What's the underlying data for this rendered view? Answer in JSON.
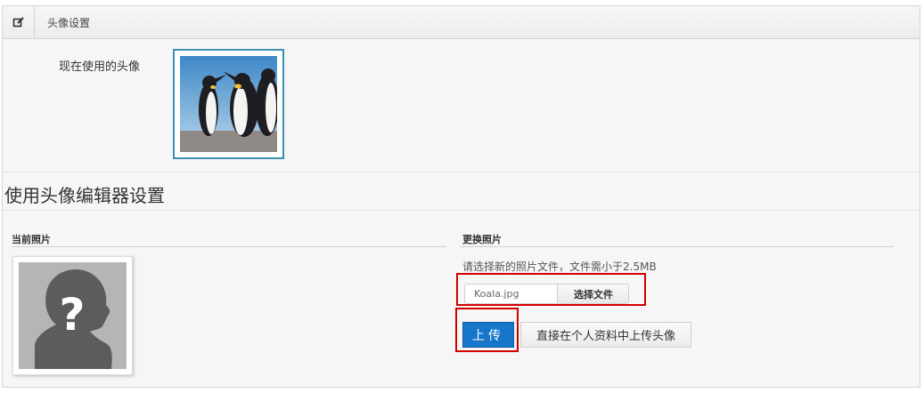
{
  "header": {
    "icon": "edit-icon",
    "title": "头像设置"
  },
  "current_avatar": {
    "label": "现在使用的头像"
  },
  "editor": {
    "section_title": "使用头像编辑器设置",
    "current_photo": {
      "title": "当前照片",
      "placeholder_icon": "unknown-person-icon"
    },
    "change_photo": {
      "title": "更换照片",
      "hint": "请选择新的照片文件，文件需小于2.5MB",
      "file_name": "Koala.jpg",
      "choose_file_label": "选择文件",
      "upload_label": "上传",
      "profile_upload_label": "直接在个人资料中上传头像"
    }
  },
  "colors": {
    "upload_button": "#1676c9",
    "highlight": "#d40000",
    "avatar_border": "#3a8fb3"
  }
}
